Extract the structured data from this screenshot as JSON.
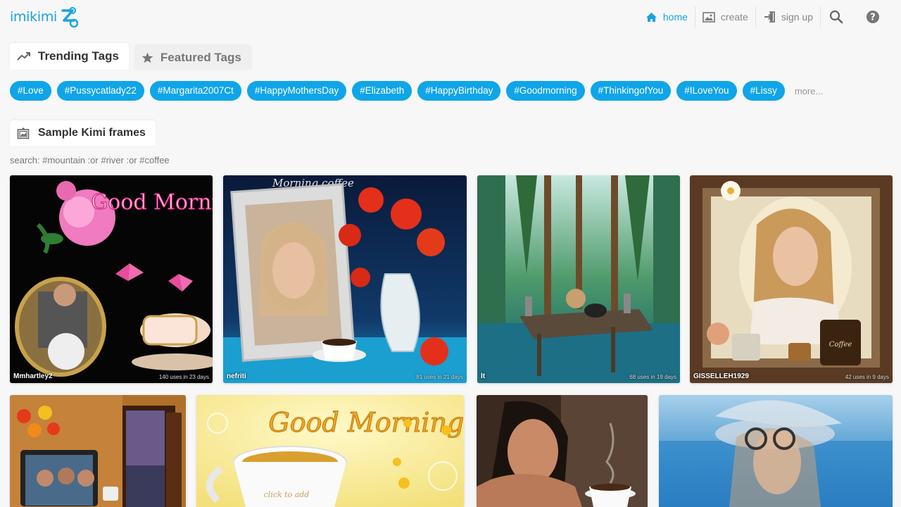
{
  "app": {
    "logo_text": "imikimi"
  },
  "nav": {
    "home": "home",
    "create": "create",
    "sign_up": "sign up"
  },
  "tabs": [
    {
      "label": "Trending Tags",
      "icon": "trending-icon"
    },
    {
      "label": "Featured Tags",
      "icon": "star-icon"
    }
  ],
  "tags": [
    "#Love",
    "#Pussycatlady22",
    "#Margarita2007Ct",
    "#HappyMothersDay",
    "#Elizabeth",
    "#HappyBirthday",
    "#Goodmorning",
    "#ThinkingofYou",
    "#ILoveYou",
    "#Lissy"
  ],
  "more_label": "more...",
  "section": {
    "title": "Sample Kimi frames",
    "search_hint": "search: #mountain :or #river :or #coffee"
  },
  "cards_row1": [
    {
      "user": "Mmhartley2",
      "uses": "140 uses in 23 days",
      "overlay_text": "Good Morning"
    },
    {
      "user": "nefriti",
      "uses": "81 uses in 21 days",
      "overlay_text": "Morning coffee"
    },
    {
      "user": "lt",
      "uses": "68 uses in 19 days"
    },
    {
      "user": "GISSELLEH1929",
      "uses": "42 uses in 9 days",
      "overlay_text": "Coffee"
    }
  ],
  "cards_row2": [
    {
      "overlay_text": ""
    },
    {
      "overlay_text": "Good Morning !",
      "overlay_small": "click to add"
    },
    {
      "overlay_text": ""
    },
    {
      "overlay_text": ""
    }
  ],
  "colors": {
    "accent": "#1aa3e0",
    "chip": "#0fa5e8"
  }
}
